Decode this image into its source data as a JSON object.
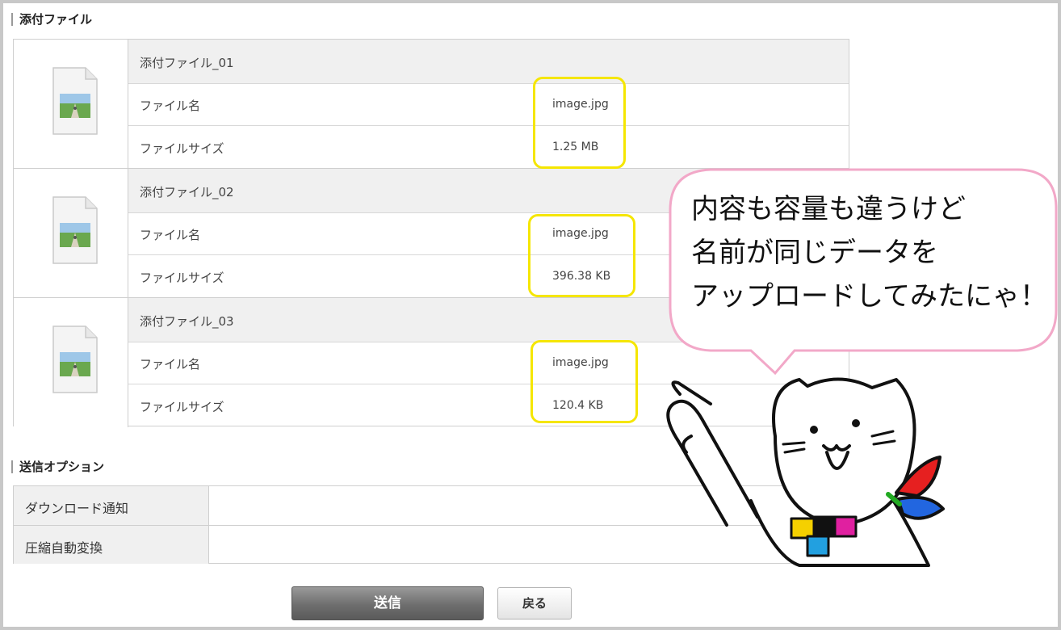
{
  "attachments": {
    "section_title": "添付ファイル",
    "items": [
      {
        "title": "添付ファイル_01",
        "name_label": "ファイル名",
        "name_value": "image.jpg",
        "size_label": "ファイルサイズ",
        "size_value": "1.25 MB"
      },
      {
        "title": "添付ファイル_02",
        "name_label": "ファイル名",
        "name_value": "image.jpg",
        "size_label": "ファイルサイズ",
        "size_value": "396.38 KB"
      },
      {
        "title": "添付ファイル_03",
        "name_label": "ファイル名",
        "name_value": "image.jpg",
        "size_label": "ファイルサイズ",
        "size_value": "120.4 KB"
      }
    ]
  },
  "options": {
    "section_title": "送信オプション",
    "rows": [
      {
        "label": "ダウンロード通知"
      },
      {
        "label": "圧縮自動変換"
      }
    ]
  },
  "buttons": {
    "send": "送信",
    "back": "戻る"
  },
  "annotation": {
    "lines": [
      "内容も容量も違うけど",
      "名前が同じデータを",
      "アップロードしてみたにゃ！"
    ],
    "highlight_color": "#f5e600",
    "bubble_border_color": "#f2a8c8"
  },
  "icons": [
    "image-file-icon",
    "cat-mascot"
  ]
}
